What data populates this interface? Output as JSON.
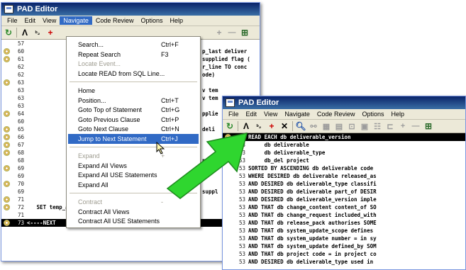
{
  "win1": {
    "title": "PAD Editor",
    "menu": [
      "File",
      "Edit",
      "View",
      "Navigate",
      "Code Review",
      "Options",
      "Help"
    ],
    "open_menu_index": 3
  },
  "win2": {
    "title": "PAD Editor",
    "menu": [
      "File",
      "Edit",
      "View",
      "Navigate",
      "Code Review",
      "Options",
      "Help"
    ]
  },
  "dropdown": [
    {
      "label": "Search...",
      "shortcut": "Ctrl+F",
      "disabled": false
    },
    {
      "label": "Repeat Search",
      "shortcut": "F3",
      "disabled": false
    },
    {
      "label": "Locate Event...",
      "shortcut": "",
      "disabled": true
    },
    {
      "label": "Locate READ from SQL Line...",
      "shortcut": "",
      "disabled": false
    },
    {
      "separator": true
    },
    {
      "label": "Home",
      "shortcut": "",
      "disabled": false
    },
    {
      "label": "Position...",
      "shortcut": "Ctrl+T",
      "disabled": false
    },
    {
      "label": "Goto Top of Statement",
      "shortcut": "Ctrl+G",
      "disabled": false
    },
    {
      "label": "Goto Previous Clause",
      "shortcut": "Ctrl+P",
      "disabled": false
    },
    {
      "label": "Goto Next Clause",
      "shortcut": "Ctrl+N",
      "disabled": false
    },
    {
      "label": "Jump to Next Statement",
      "shortcut": "Ctrl+J",
      "disabled": false,
      "active": true
    },
    {
      "separator": true
    },
    {
      "label": "Expand",
      "shortcut": "+",
      "disabled": true
    },
    {
      "label": "Expand All Views",
      "shortcut": "",
      "disabled": false
    },
    {
      "label": "Expand All USE Statements",
      "shortcut": "",
      "disabled": false
    },
    {
      "label": "Expand All",
      "shortcut": "",
      "disabled": false
    },
    {
      "separator": true
    },
    {
      "label": "Contract",
      "shortcut": "-",
      "disabled": true
    },
    {
      "label": "Contract All Views",
      "shortcut": "",
      "disabled": false
    },
    {
      "label": "Contract All USE Statements",
      "shortcut": "",
      "disabled": false
    }
  ],
  "editor1": {
    "lines": [
      {
        "num": "57",
        "code": "",
        "gear": false,
        "hl": false
      },
      {
        "num": "60",
        "code": "",
        "gear": true,
        "hl": false
      },
      {
        "num": "61",
        "code": "",
        "gear": true,
        "hl": false
      },
      {
        "num": "62",
        "code": "",
        "gear": false,
        "hl": false
      },
      {
        "num": "62",
        "code": "",
        "gear": false,
        "hl": false
      },
      {
        "num": "63",
        "code": "",
        "gear": true,
        "hl": false
      },
      {
        "num": "63",
        "code": "",
        "gear": false,
        "hl": false
      },
      {
        "num": "63",
        "code": "",
        "gear": false,
        "hl": false
      },
      {
        "num": "63",
        "code": "",
        "gear": false,
        "hl": false
      },
      {
        "num": "64",
        "code": "",
        "gear": true,
        "hl": false
      },
      {
        "num": "60",
        "code": "",
        "gear": false,
        "hl": false
      },
      {
        "num": "65",
        "code": "",
        "gear": true,
        "hl": false
      },
      {
        "num": "66",
        "code": "",
        "gear": true,
        "hl": false
      },
      {
        "num": "67",
        "code": "",
        "gear": true,
        "hl": false
      },
      {
        "num": "68",
        "code": "",
        "gear": true,
        "hl": false
      },
      {
        "num": "68",
        "code": "",
        "gear": false,
        "hl": false
      },
      {
        "num": "69",
        "code": "",
        "gear": true,
        "hl": false
      },
      {
        "num": "69",
        "code": "",
        "gear": false,
        "hl": false
      },
      {
        "num": "70",
        "code": "",
        "gear": true,
        "hl": false
      },
      {
        "num": "69",
        "code": "",
        "gear": false,
        "hl": false
      },
      {
        "num": "71",
        "code": "",
        "gear": true,
        "hl": false
      },
      {
        "num": "72",
        "code": "   SET temp_all_withdrawn ief_supp",
        "gear": true,
        "hl": false
      },
      {
        "num": "71",
        "code": "",
        "gear": false,
        "hl": false
      },
      {
        "num": "73",
        "code": "<----NEXT",
        "gear": true,
        "hl": true
      }
    ],
    "snippets": [
      "p_last deliver",
      "supplied flag (",
      "r_line TO conc",
      "ode)",
      "v tem",
      "v tem",
      "pplie",
      "deli",
      "n pr",
      "lied",
      "suppl"
    ]
  },
  "editor2": {
    "lines": [
      {
        "num": "53",
        "code": "READ EACH db deliverable_version",
        "gear": true,
        "hl": true
      },
      {
        "num": "53",
        "code": "     db deliverable",
        "gear": false,
        "hl": false
      },
      {
        "num": "53",
        "code": "     db deliverable_type",
        "gear": false,
        "hl": false
      },
      {
        "num": "53",
        "code": "     db_del project",
        "gear": false,
        "hl": false
      },
      {
        "num": "53",
        "code": "SORTED BY ASCENDING db deliverable code",
        "gear": false,
        "hl": false
      },
      {
        "num": "53",
        "code": "WHERE DESIRED db deliverable released_as",
        "gear": false,
        "hl": false
      },
      {
        "num": "53",
        "code": "AND DESIRED db deliverable_type classifi",
        "gear": false,
        "hl": false
      },
      {
        "num": "53",
        "code": "AND DESIRED db deliverable part_of DESIR",
        "gear": false,
        "hl": false
      },
      {
        "num": "53",
        "code": "AND DESIRED db deliverable_version imple",
        "gear": false,
        "hl": false
      },
      {
        "num": "53",
        "code": "AND THAT db change_content content_of SO",
        "gear": false,
        "hl": false
      },
      {
        "num": "53",
        "code": "AND THAT db change_request included_with",
        "gear": false,
        "hl": false
      },
      {
        "num": "53",
        "code": "AND THAT db release_pack authorises SOME",
        "gear": false,
        "hl": false
      },
      {
        "num": "53",
        "code": "AND THAT db system_update_scope defines",
        "gear": false,
        "hl": false
      },
      {
        "num": "53",
        "code": "AND THAT db system_update number = in sy",
        "gear": false,
        "hl": false
      },
      {
        "num": "53",
        "code": "AND THAT db system_update defined_by SOM",
        "gear": false,
        "hl": false
      },
      {
        "num": "53",
        "code": "AND THAT db project code = in project co",
        "gear": false,
        "hl": false
      },
      {
        "num": "53",
        "code": "AND DESIRED db deliverable_type used in",
        "gear": false,
        "hl": false
      }
    ]
  }
}
